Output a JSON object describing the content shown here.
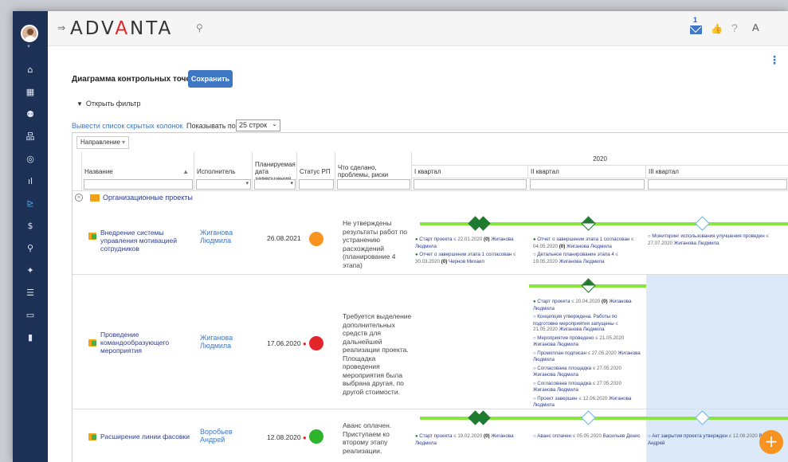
{
  "app": {
    "logo_left": "ADV",
    "logo_a": "A",
    "logo_right": "NTA"
  },
  "header": {
    "mail_count": "1",
    "lang": "A",
    "help": "?"
  },
  "icons": {
    "menu": "menu-toggle-icon",
    "search": "search-icon",
    "mail": "mail-icon",
    "like": "like-icon",
    "help": "help-icon",
    "language": "language-icon"
  },
  "sidebar": {
    "items": [
      {
        "name": "home",
        "glyph": "⌂"
      },
      {
        "name": "calendar",
        "glyph": "▦"
      },
      {
        "name": "users",
        "glyph": "⚉"
      },
      {
        "name": "structure",
        "glyph": "品"
      },
      {
        "name": "target",
        "glyph": "◎"
      },
      {
        "name": "analytics",
        "glyph": "ıl"
      },
      {
        "name": "gantt",
        "glyph": "⊵"
      },
      {
        "name": "finance",
        "glyph": "$"
      },
      {
        "name": "runner",
        "glyph": "⚲"
      },
      {
        "name": "sparkle",
        "glyph": "✦"
      },
      {
        "name": "checklist",
        "glyph": "☰"
      },
      {
        "name": "monitor",
        "glyph": "▭"
      },
      {
        "name": "bookmark",
        "glyph": "▮"
      }
    ]
  },
  "page": {
    "title": "Диаграмма контрольных точек",
    "save_label": "Сохранить",
    "filter_label": "Открыть фильтр",
    "hidden_columns_label": "Вывести список скрытых колонок",
    "show_label": "Показывать по",
    "per_page": "25 строк",
    "group_by": "Направление"
  },
  "table": {
    "headers": {
      "name": "Название",
      "executor": "Исполнитель",
      "planned_date": "Планируемая дата завершения",
      "status": "Статус РП",
      "done": "Что сделано, проблемы, риски",
      "year": "2020",
      "q1": "I квартал",
      "q2": "II квартал",
      "q3": "III квартал"
    },
    "group": "Организационные проекты",
    "rows": [
      {
        "name": "Внедрение системы управления мотивацией сотрудников",
        "executor": "Жиганова Людмила",
        "date": "26.08.2021",
        "status_color": "#f7931e",
        "done": "Не утверждены результаты работ по устранению расхождений (планирование 4 этапа)",
        "q1": [
          {
            "marker": "●",
            "text": "Старт проекта",
            "date": "22.01.2020",
            "extra": "(0)",
            "person": "Жиганова Людмила"
          },
          {
            "marker": "●",
            "text": "Отчет о завершении этапа 1 согласован",
            "date": "30.03.2020",
            "extra": "(0)",
            "person": "Чернов Михаил"
          }
        ],
        "q2": [
          {
            "marker": "●",
            "text": "Отчет о завершении этапа 1 согласован",
            "date": "04.05.2020",
            "extra": "(0)",
            "person": "Жиганова Людмила"
          },
          {
            "marker": "○",
            "text": "Детальное планирование этапа 4",
            "date": "19.05.2020",
            "extra": "",
            "person": "Жиганова Людмила"
          }
        ],
        "q3": [
          {
            "marker": "○",
            "text": "Мониторинг использования улучшения проведен",
            "date": "27.07.2020",
            "extra": "",
            "person": "Жиганова Людмила"
          }
        ]
      },
      {
        "name": "Проведение командообразующего мероприятия",
        "executor": "Жиганова Людмила",
        "date": "17.06.2020",
        "status_color": "#e3262c",
        "done": "Требуется выделение дополнительных средств для дальнейшей реализации проекта. Площадка проведения мероприятия была выбрана другая, по другой стоимости.",
        "q2": [
          {
            "marker": "●",
            "text": "Старт проекта",
            "date": "20.04.2020",
            "extra": "(0)",
            "person": "Жиганова Людмила"
          },
          {
            "marker": "○",
            "text": "Концепция утверждена. Работы по подготовке мероприятия запущены",
            "date": "21.05.2020",
            "extra": "",
            "person": "Жиганова Людмила"
          },
          {
            "marker": "○",
            "text": "Мероприятие проведено",
            "date": "21.05.2020",
            "extra": "",
            "person": "Жиганова Людмила"
          },
          {
            "marker": "○",
            "text": "Промоплан подписан",
            "date": "27.05.2020",
            "extra": "",
            "person": "Жиганова Людмила"
          },
          {
            "marker": "○",
            "text": "Согласована площадка",
            "date": "27.05.2020",
            "extra": "",
            "person": "Жиганова Людмила"
          },
          {
            "marker": "○",
            "text": "Согласована площадка",
            "date": "27.05.2020",
            "extra": "",
            "person": "Жиганова Людмила"
          },
          {
            "marker": "○",
            "text": "Проект завершен",
            "date": "12.06.2020",
            "extra": "",
            "person": "Жиганова Людмила"
          }
        ]
      },
      {
        "name": "Расширение линии фасовки",
        "executor": "Воробьев Андрей",
        "date": "12.08.2020",
        "status_color": "#2cb52c",
        "done": "Аванс оплачен. Приступаем ко второму этапу реализации.",
        "q1": [
          {
            "marker": "●",
            "text": "Старт проекта",
            "date": "19.02.2020",
            "extra": "(0)",
            "person": "Жиганова Людмила"
          }
        ],
        "q2": [
          {
            "marker": "○",
            "text": "Аванс оплачен",
            "date": "05.05.2020",
            "extra": "",
            "person": "Васильев Денис"
          }
        ],
        "q3": [
          {
            "marker": "○",
            "text": "Акт закрытия проекта утвержден",
            "date": "12.08.2020",
            "extra": "",
            "person": "Воробьев Андрей"
          }
        ]
      }
    ]
  },
  "fab": "+"
}
